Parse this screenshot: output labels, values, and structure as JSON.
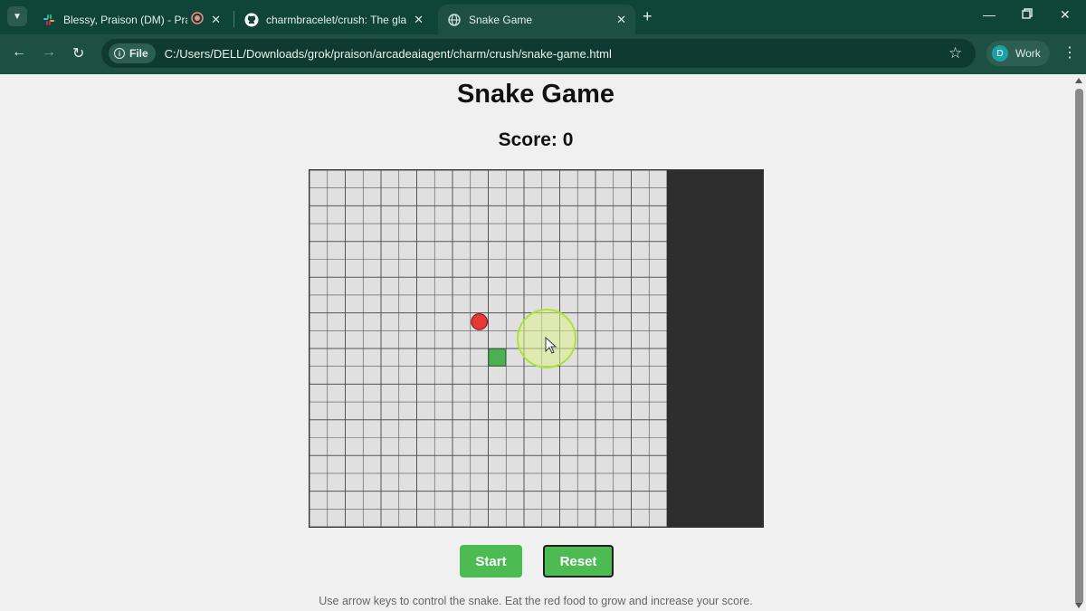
{
  "browser": {
    "tabs": [
      {
        "title": "Blessy, Praison (DM) - Praison",
        "active": false,
        "icon": "slack-icon"
      },
      {
        "title": "charmbracelet/crush: The glamourous",
        "active": false,
        "icon": "github-icon"
      },
      {
        "title": "Snake Game",
        "active": true,
        "icon": "globe-icon"
      }
    ],
    "new_tab_label": "+",
    "address_chip": "File",
    "url": "C:/Users/DELL/Downloads/grok/praison/arcadeaiagent/charm/crush/snake-game.html",
    "profile_initial": "D",
    "profile_label": "Work"
  },
  "page": {
    "title": "Snake Game",
    "score_label": "Score: 0",
    "start_label": "Start",
    "reset_label": "Reset",
    "instructions": "Use arrow keys to control the snake. Eat the red food to grow and increase your score."
  },
  "game": {
    "grid_cols": 20,
    "grid_rows": 20,
    "food": {
      "col": 9,
      "row": 8,
      "color": "#e53935"
    },
    "snake": [
      {
        "col": 10,
        "row": 10
      }
    ],
    "snake_color": "#4caf50",
    "cell_color": "#e0e0e0",
    "grid_line_color": "#555555"
  },
  "colors": {
    "chrome": "#0f4438",
    "button": "#4cbb52",
    "page_bg": "#f0f0f0"
  }
}
